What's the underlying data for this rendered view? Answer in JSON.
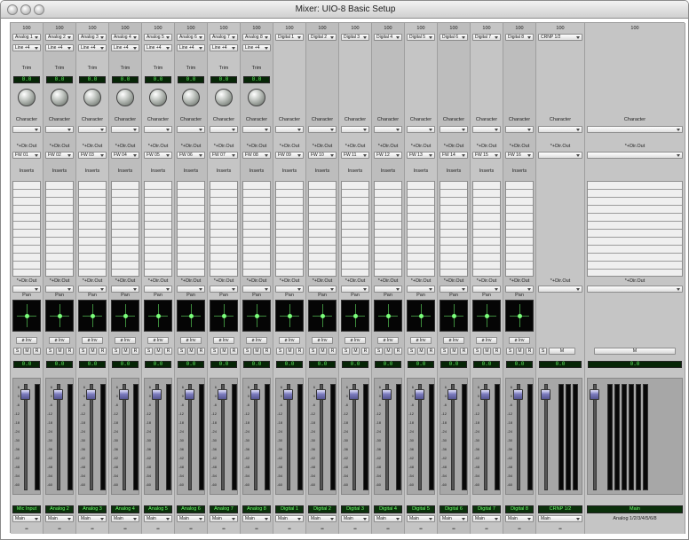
{
  "window": {
    "title": "Mixer: UIO-8 Basic Setup"
  },
  "labels": {
    "trim": "Trim",
    "character": "Character",
    "dir_out": "*+Dir.Out",
    "inserts": "Inserts",
    "pan": "Pan",
    "inv": "ø Inv",
    "solo": "S",
    "mute": "M",
    "rec": "R",
    "main": "Main",
    "footer_mark": "••",
    "send_level": "100"
  },
  "channels": [
    {
      "input": "Analog 1",
      "gain": "Line +4",
      "trim": "0.0",
      "dir": "FW 01",
      "level": "0.0",
      "name": "Mic Input"
    },
    {
      "input": "Analog 2",
      "gain": "Line +4",
      "trim": "0.0",
      "dir": "FW 02",
      "level": "0.0",
      "name": "Analog 2"
    },
    {
      "input": "Analog 3",
      "gain": "Line +4",
      "trim": "0.0",
      "dir": "FW 03",
      "level": "0.0",
      "name": "Analog 3"
    },
    {
      "input": "Analog 4",
      "gain": "Line +4",
      "trim": "0.0",
      "dir": "FW 04",
      "level": "0.0",
      "name": "Analog 4"
    },
    {
      "input": "Analog 5",
      "gain": "Line +4",
      "trim": "0.0",
      "dir": "FW 05",
      "level": "0.0",
      "name": "Analog 5"
    },
    {
      "input": "Analog 6",
      "gain": "Line +4",
      "trim": "0.0",
      "dir": "FW 06",
      "level": "0.0",
      "name": "Analog 6"
    },
    {
      "input": "Analog 7",
      "gain": "Line +4",
      "trim": "0.0",
      "dir": "FW 07",
      "level": "0.0",
      "name": "Analog 7"
    },
    {
      "input": "Analog 8",
      "gain": "Line +4",
      "trim": "0.0",
      "dir": "FW 08",
      "level": "0.0",
      "name": "Analog 8"
    },
    {
      "input": "Digital 1",
      "dir": "FW 09",
      "level": "0.0",
      "name": "Digital 1"
    },
    {
      "input": "Digital 2",
      "dir": "FW 10",
      "level": "0.0",
      "name": "Digital 2"
    },
    {
      "input": "Digital 3",
      "dir": "FW 11",
      "level": "0.0",
      "name": "Digital 3"
    },
    {
      "input": "Digital 4",
      "dir": "FW 12",
      "level": "0.0",
      "name": "Digital 4"
    },
    {
      "input": "Digital 5",
      "dir": "FW 13",
      "level": "0.0",
      "name": "Digital 5"
    },
    {
      "input": "Digital 6",
      "dir": "FW 14",
      "level": "0.0",
      "name": "Digital 6"
    },
    {
      "input": "Digital 7",
      "dir": "FW 15",
      "level": "0.0",
      "name": "Digital 7"
    },
    {
      "input": "Digital 8",
      "dir": "FW 16",
      "level": "0.0",
      "name": "Digital 8"
    }
  ],
  "bus": {
    "input": "CRNP 1/2",
    "level": "0.0",
    "name": "CRNP 1/2"
  },
  "master": {
    "label": "Main",
    "level": "0.0",
    "name": "Main",
    "out": "Analog 1/2/3/4/5/6/8"
  },
  "fader_scale": [
    "6",
    "0",
    "-6",
    "-12",
    "-18",
    "-24",
    "-30",
    "-36",
    "-42",
    "-48",
    "-54",
    "-60"
  ]
}
